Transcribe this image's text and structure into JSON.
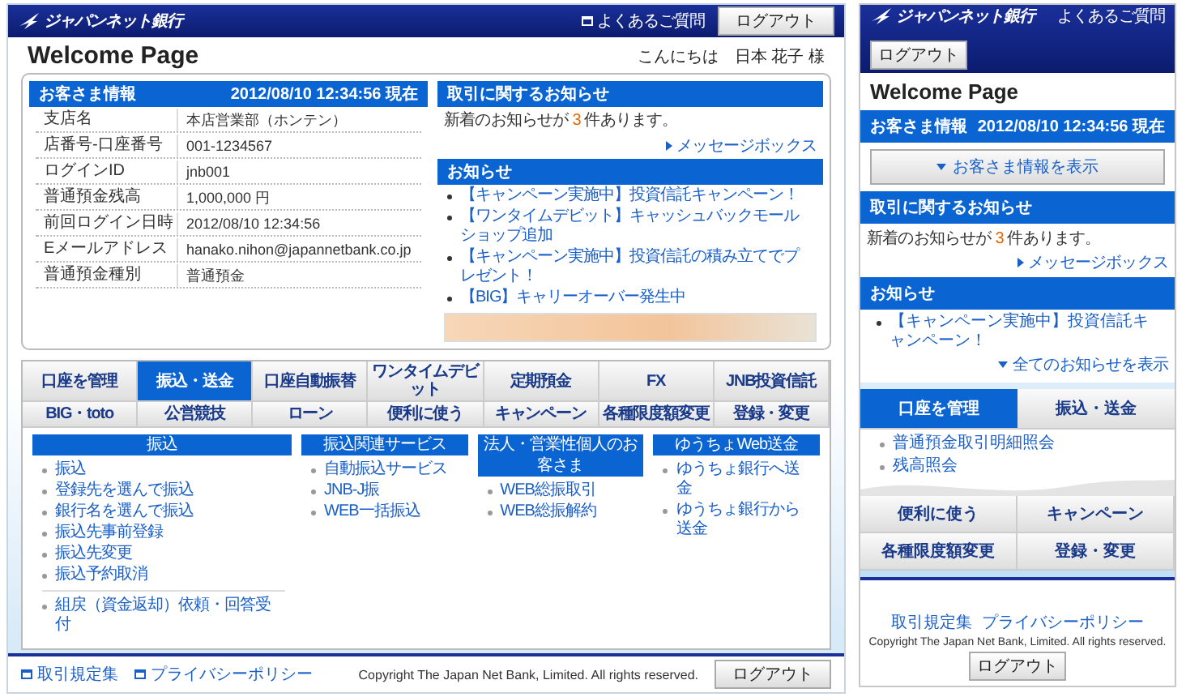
{
  "desktop": {
    "header": {
      "logo": "ジャパンネット銀行",
      "faq": "よくあるご質問",
      "logout": "ログアウト"
    },
    "title": "Welcome Page",
    "greeting": "こんにちは　日本 花子 様",
    "customer_info": {
      "title": "お客さま情報",
      "timestamp": "2012/08/10 12:34:56 現在",
      "rows": [
        {
          "label": "支店名",
          "value": "本店営業部（ホンテン）"
        },
        {
          "label": "店番号-口座番号",
          "value": "001-1234567"
        },
        {
          "label": "ログインID",
          "value": "jnb001"
        },
        {
          "label": "普通預金残高",
          "value": "1,000,000 円"
        },
        {
          "label": "前回ログイン日時",
          "value": "2012/08/10 12:34:56"
        },
        {
          "label": "Eメールアドレス",
          "value": "hanako.nihon@japannetbank.co.jp"
        },
        {
          "label": "普通預金種別",
          "value": "普通預金"
        }
      ]
    },
    "transaction_notices": {
      "title": "取引に関するお知らせ",
      "message": {
        "prefix": "新着のお知らせが ",
        "count": "3",
        "suffix": " 件あります。"
      },
      "link": "メッセージボックス"
    },
    "news": {
      "title": "お知らせ",
      "items": [
        "【キャンペーン実施中】投資信託キャンペーン！",
        "【ワンタイムデビット】キャッシュバックモールショップ追加",
        "【キャンペーン実施中】投資信託の積み立てでプレゼント！",
        "【BIG】キャリーオーバー発生中"
      ]
    },
    "tabs": [
      {
        "label": "口座を管理",
        "selected": false
      },
      {
        "label": "振込・送金",
        "selected": true
      },
      {
        "label": "口座自動振替",
        "selected": false
      },
      {
        "label": "ワンタイムデビット",
        "selected": false
      },
      {
        "label": "定期預金",
        "selected": false
      },
      {
        "label": "FX",
        "selected": false
      },
      {
        "label": "JNB投資信託",
        "selected": false
      },
      {
        "label": "BIG・toto",
        "selected": false
      },
      {
        "label": "公営競技",
        "selected": false
      },
      {
        "label": "ローン",
        "selected": false
      },
      {
        "label": "便利に使う",
        "selected": false
      },
      {
        "label": "キャンペーン",
        "selected": false
      },
      {
        "label": "各種限度額変更",
        "selected": false
      },
      {
        "label": "登録・変更",
        "selected": false
      }
    ],
    "menu_columns": [
      {
        "title": "振込",
        "items": [
          "振込",
          "登録先を選んで振込",
          "銀行名を選んで振込",
          "振込先事前登録",
          "振込先変更",
          "振込予約取消"
        ],
        "extra_items": [
          "組戻（資金返却）依頼・回答受付"
        ]
      },
      {
        "title": "振込関連サービス",
        "items": [
          "自動振込サービス",
          "JNB-J振",
          "WEB一括振込"
        ]
      },
      {
        "title": "法人・営業性個人のお客さま",
        "items": [
          "WEB総振取引",
          "WEB総振解約"
        ]
      },
      {
        "title": "ゆうちょWeb送金",
        "items": [
          "ゆうちょ銀行へ送金",
          "ゆうちょ銀行から送金"
        ]
      }
    ],
    "footer": {
      "links": [
        "取引規定集",
        "プライバシーポリシー"
      ],
      "copyright": "Copyright The Japan Net Bank, Limited. All rights reserved.",
      "logout": "ログアウト"
    }
  },
  "mobile": {
    "header": {
      "logo": "ジャパンネット銀行",
      "faq": "よくあるご質問",
      "logout": "ログアウト"
    },
    "title": "Welcome Page",
    "customer_info": {
      "title": "お客さま情報",
      "timestamp": "2012/08/10 12:34:56 現在",
      "toggle": "お客さま情報を表示"
    },
    "transaction_notices": {
      "title": "取引に関するお知らせ",
      "message": {
        "prefix": "新着のお知らせが ",
        "count": "3",
        "suffix": " 件あります。"
      },
      "link": "メッセージボックス"
    },
    "news": {
      "title": "お知らせ",
      "items": [
        "【キャンペーン実施中】投資信託キャンペーン！"
      ],
      "more": "全てのお知らせを表示"
    },
    "tabs": [
      {
        "label": "口座を管理",
        "selected": true
      },
      {
        "label": "振込・送金",
        "selected": false
      }
    ],
    "tab_links": [
      "普通預金取引明細照会",
      "残高照会"
    ],
    "buttons": [
      "便利に使う",
      "キャンペーン",
      "各種限度額変更",
      "登録・変更"
    ],
    "footer": {
      "links": [
        "取引規定集",
        "プライバシーポリシー"
      ],
      "copyright": "Copyright The Japan Net Bank, Limited. All rights reserved.",
      "logout": "ログアウト"
    }
  }
}
